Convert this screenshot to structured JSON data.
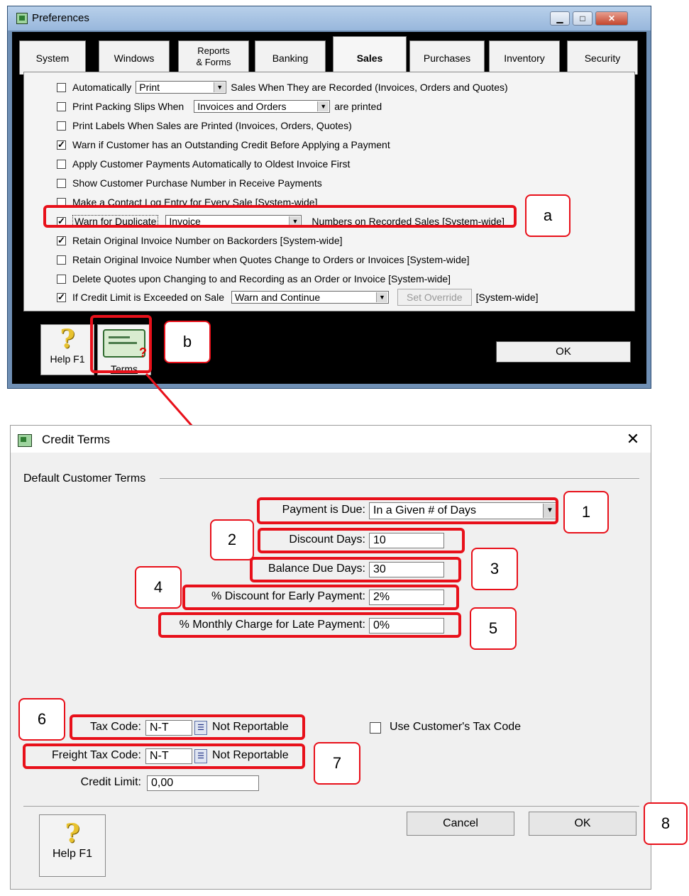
{
  "preferences": {
    "title": "Preferences",
    "tabs": [
      {
        "label": "System"
      },
      {
        "label": "Windows"
      },
      {
        "label_line1": "Reports",
        "label_line2": "& Forms"
      },
      {
        "label": "Banking"
      },
      {
        "label": "Sales"
      },
      {
        "label": "Purchases"
      },
      {
        "label": "Inventory"
      },
      {
        "label": "Security"
      }
    ],
    "active_tab": "Sales",
    "options": {
      "auto_print": {
        "label_pre": "Automatically",
        "combo": "Print",
        "label_post": "Sales When They are Recorded (Invoices, Orders and Quotes)",
        "checked": false
      },
      "packing_slips": {
        "label_pre": "Print Packing Slips When",
        "combo": "Invoices and Orders",
        "label_post": "are printed",
        "checked": false
      },
      "print_labels": {
        "label": "Print Labels When Sales are Printed (Invoices, Orders, Quotes)",
        "checked": false
      },
      "warn_credit": {
        "label": "Warn if Customer has an Outstanding Credit Before Applying a Payment",
        "checked": true
      },
      "apply_payments": {
        "label": "Apply Customer Payments Automatically to Oldest Invoice First",
        "checked": false
      },
      "show_po": {
        "label": "Show Customer Purchase Number in Receive Payments",
        "checked": false
      },
      "contact_log": {
        "label": "Make a Contact Log Entry for Every Sale [System-wide]",
        "checked": false
      },
      "warn_duplicate": {
        "label_pre": "Warn for Duplicate",
        "combo": "Invoice",
        "label_post": "Numbers on Recorded Sales [System-wide]",
        "checked": true
      },
      "retain_backorders": {
        "label": "Retain Original Invoice Number on Backorders [System-wide]",
        "checked": true
      },
      "retain_quotes": {
        "label": "Retain Original Invoice Number when Quotes Change to Orders or Invoices [System-wide]",
        "checked": false
      },
      "delete_quotes": {
        "label": "Delete Quotes upon Changing to and Recording as an Order or Invoice [System-wide]",
        "checked": false
      },
      "credit_limit": {
        "label_pre": "If Credit Limit is Exceeded on Sale",
        "combo": "Warn and Continue",
        "button": "Set Override",
        "label_post": "[System-wide]",
        "checked": true
      }
    },
    "help_label": "Help F1",
    "terms_label": "Terms",
    "ok_label": "OK"
  },
  "credit_terms": {
    "title": "Credit Terms",
    "close_glyph": "✕",
    "group_label": "Default Customer Terms",
    "payment_due": {
      "label": "Payment is Due:",
      "value": "In a Given # of Days"
    },
    "discount_days": {
      "label": "Discount Days:",
      "value": "10"
    },
    "balance_due_days": {
      "label": "Balance Due Days:",
      "value": "30"
    },
    "early_discount": {
      "label": "% Discount for Early Payment:",
      "value": "2%"
    },
    "late_charge": {
      "label": "% Monthly Charge for Late Payment:",
      "value": "0%"
    },
    "tax_code": {
      "label": "Tax Code:",
      "value": "N-T",
      "desc": "Not Reportable"
    },
    "freight_tax_code": {
      "label": "Freight Tax Code:",
      "value": "N-T",
      "desc": "Not Reportable"
    },
    "credit_limit": {
      "label": "Credit Limit:",
      "value": "0,00"
    },
    "use_customer_tax": {
      "label": "Use Customer's Tax Code",
      "checked": false
    },
    "cancel_label": "Cancel",
    "ok_label": "OK",
    "help_label": "Help F1"
  },
  "callouts": {
    "a": "a",
    "b": "b",
    "n1": "1",
    "n2": "2",
    "n3": "3",
    "n4": "4",
    "n5": "5",
    "n6": "6",
    "n7": "7",
    "n8": "8"
  },
  "colors": {
    "annotation_red": "#e8101a",
    "window_frame": "#6f8fb4",
    "help_icon_yellow": "#e8c22e"
  },
  "icons": [
    "app-window-icon",
    "help-question-icon",
    "terms-certificate-icon",
    "dropdown-arrow-icon",
    "lookup-list-icon",
    "close-icon"
  ]
}
